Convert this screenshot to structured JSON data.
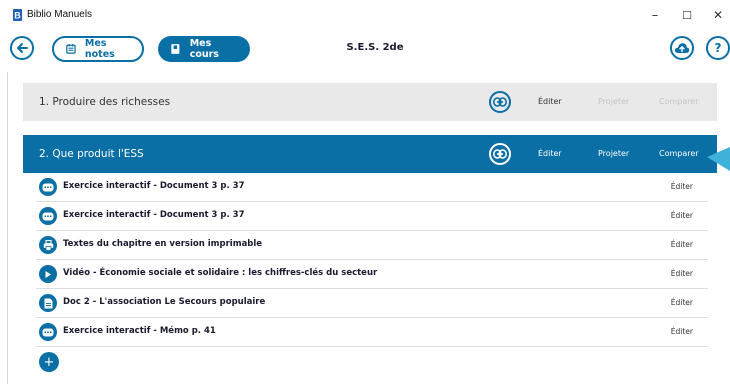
{
  "window": {
    "title": "Biblio Manuels",
    "minimize": "–",
    "maximize": "☐",
    "close": "✕"
  },
  "toolbar": {
    "back_icon": "arrow-left-icon",
    "notes_label": "Mes notes",
    "courses_label": "Mes cours",
    "page_title": "S.E.S. 2de",
    "help_label": "?",
    "upload_icon": "cloud-upload-icon"
  },
  "chapters": [
    {
      "title": "1. Produire des richesses",
      "edit": "Éditer",
      "project": "Projeter",
      "compare": "Comparer",
      "active": false
    },
    {
      "title": "2. Que produit l'ESS",
      "edit": "Éditer",
      "project": "Projeter",
      "compare": "Comparer",
      "active": true
    }
  ],
  "resources": [
    {
      "icon": "interactive-exercise-icon",
      "label": "Exercice interactif - Document 3 p. 37",
      "edit": "Éditer"
    },
    {
      "icon": "interactive-exercise-icon",
      "label": "Exercice interactif - Document 3 p. 37",
      "edit": "Éditer"
    },
    {
      "icon": "print-icon",
      "label": "Textes du chapitre en version imprimable",
      "edit": "Éditer"
    },
    {
      "icon": "play-icon",
      "label": "Vidéo - Économie sociale et solidaire : les chiffres-clés du secteur",
      "edit": "Éditer"
    },
    {
      "icon": "document-icon",
      "label": "Doc 2 - L'association Le Secours populaire",
      "edit": "Éditer"
    },
    {
      "icon": "interactive-exercise-icon",
      "label": "Exercice interactif - Mémo p. 41",
      "edit": "Éditer"
    }
  ],
  "add_label": "+",
  "colors": {
    "accent": "#0a6fa4",
    "chapter_inactive_bg": "#e9e9e9",
    "pointer": "#3fb2d9"
  }
}
